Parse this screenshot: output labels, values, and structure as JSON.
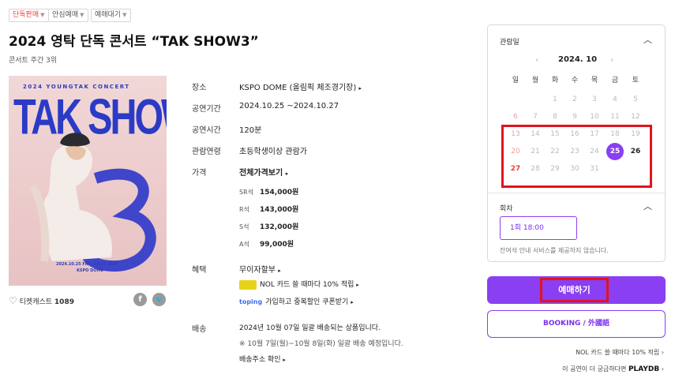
{
  "tags": [
    {
      "label": "단독판매",
      "color": "#e8423a"
    },
    {
      "label": "안심예매",
      "color": "#555555"
    },
    {
      "label": "예매대기",
      "color": "#555555"
    }
  ],
  "title": "2024 영탁 단독 콘서트 “TAK SHOW3”",
  "rank": "콘서트 주간 3위",
  "poster": {
    "top_text": "2024 YOUNGTAK CONCERT",
    "main_text": "TAK SHOW",
    "number": "3",
    "date_text": "2024.10.25 FRI - 10.27 SUN",
    "venue_text": "KSPO DOME"
  },
  "ticketcast": {
    "label": "티켓캐스트",
    "count": "1089"
  },
  "info": {
    "venue_label": "장소",
    "venue_value": "KSPO DOME (올림픽 체조경기장)",
    "period_label": "공연기간",
    "period_value": "2024.10.25 ~2024.10.27",
    "runtime_label": "공연시간",
    "runtime_value": "120분",
    "age_label": "관람연령",
    "age_value": "초등학생이상 관람가",
    "price_label": "가격",
    "price_all": "전체가격보기",
    "prices": [
      {
        "grade": "SR석",
        "price": "154,000원"
      },
      {
        "grade": "R석",
        "price": "143,000원"
      },
      {
        "grade": "S석",
        "price": "132,000원"
      },
      {
        "grade": "A석",
        "price": "99,000원"
      }
    ],
    "benefit_label": "혜택",
    "benefit_interest": "무이자할부",
    "benefit_nol": "NOL 카드 쓸 때마다 10% 적립",
    "benefit_toping_logo": "toping",
    "benefit_toping": "가입하고 중복할인 쿠폰받기",
    "delivery_label": "배송",
    "delivery_line1": "2024년 10월 07일 일괄 배송되는 상품입니다.",
    "delivery_line2": "※ 10월 7일(월)~10월 8일(화) 일괄 배송 예정입니다.",
    "delivery_link": "배송주소 확인"
  },
  "calendar": {
    "section_label": "관람일",
    "month": "2024. 10",
    "weekdays": [
      "일",
      "월",
      "화",
      "수",
      "목",
      "금",
      "토"
    ],
    "weeks": [
      [
        "",
        "",
        "1",
        "2",
        "3",
        "4",
        "5"
      ],
      [
        "6",
        "7",
        "8",
        "9",
        "10",
        "11",
        "12"
      ],
      [
        "13",
        "14",
        "15",
        "16",
        "17",
        "18",
        "19"
      ],
      [
        "20",
        "21",
        "22",
        "23",
        "24",
        "25",
        "26"
      ],
      [
        "27",
        "28",
        "29",
        "30",
        "31",
        "",
        ""
      ]
    ],
    "selected": "25"
  },
  "session": {
    "label": "회차",
    "option": "1회 18:00",
    "note": "잔여석 안내 서비스를 제공하지 않습니다."
  },
  "buttons": {
    "reserve": "예매하기",
    "booking": "BOOKING / 外國語"
  },
  "footer": {
    "nol": "NOL 카드 쓸 때마다 10% 적립",
    "playdb_text": "이 공연이 더 궁금하다면",
    "playdb_logo": "PLAYDB"
  },
  "colors": {
    "accent": "#8a3ff2",
    "highlight_box": "#e0141e",
    "sunday": "#e8423a"
  }
}
